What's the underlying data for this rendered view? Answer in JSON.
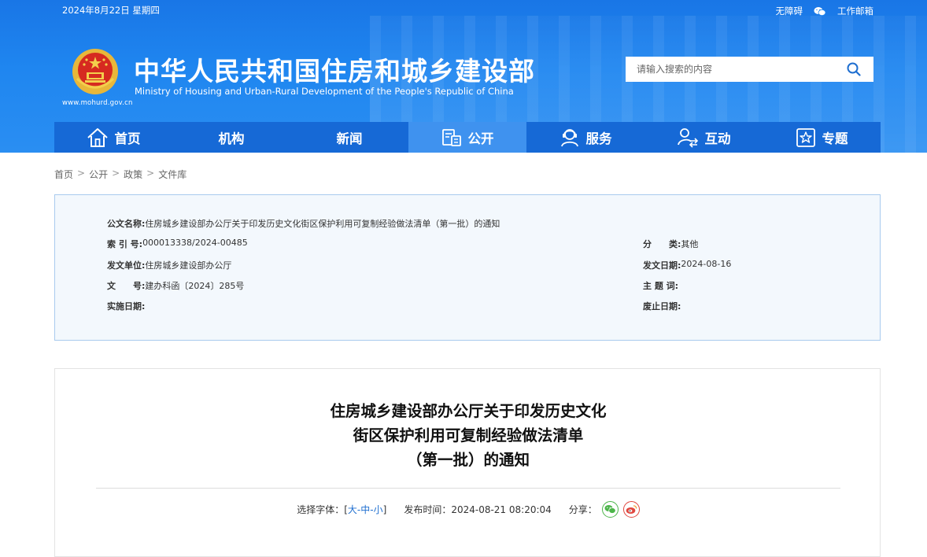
{
  "header": {
    "date": "2024年8月22日 星期四",
    "accessibility_link": "无障碍",
    "work_mail_link": "工作邮箱",
    "logo_url_text": "www.mohurd.gov.cn",
    "title_cn": "中华人民共和国住房和城乡建设部",
    "title_en": "Ministry of Housing and Urban-Rural Development of the People's Republic of China",
    "search_placeholder": "请输入搜索的内容"
  },
  "nav": {
    "items": [
      {
        "label": "首页",
        "icon": "home-icon"
      },
      {
        "label": "机构",
        "icon": ""
      },
      {
        "label": "新闻",
        "icon": ""
      },
      {
        "label": "公开",
        "icon": "document-icon",
        "active": true
      },
      {
        "label": "服务",
        "icon": "service-user-icon"
      },
      {
        "label": "互动",
        "icon": "interact-user-icon"
      },
      {
        "label": "专题",
        "icon": "star-icon"
      }
    ]
  },
  "breadcrumb": [
    "首页",
    "公开",
    "政策",
    "文件库"
  ],
  "info": {
    "doc_name_label": "公文名称:",
    "doc_name_value": "住房城乡建设部办公厅关于印发历史文化街区保护利用可复制经验做法清单（第一批）的通知",
    "index_label": "索 引 号:",
    "index_value": "000013338/2024-00485",
    "category_label": "分　　类:",
    "category_value": "其他",
    "issuer_label": "发文单位:",
    "issuer_value": "住房城乡建设部办公厅",
    "issue_date_label": "发文日期:",
    "issue_date_value": "2024-08-16",
    "doc_no_label": "文　　号:",
    "doc_no_value": "建办科函〔2024〕285号",
    "subject_label": "主 题 词:",
    "subject_value": "",
    "effective_label": "实施日期:",
    "effective_value": "",
    "expiry_label": "废止日期:",
    "expiry_value": ""
  },
  "article": {
    "title_line1": "住房城乡建设部办公厅关于印发历史文化",
    "title_line2": "街区保护利用可复制经验做法清单",
    "title_line3": "（第一批）的通知",
    "font_label": "选择字体：[",
    "font_large": "大",
    "font_medium": "中",
    "font_small": "小",
    "font_dash": "-",
    "font_close": "]",
    "publish_label": "发布时间：",
    "publish_time": "2024-08-21 08:20:04",
    "share_label": "分享：",
    "share_icons": [
      "wechat-share-icon",
      "weibo-share-icon"
    ]
  },
  "colors": {
    "header_blue": "#1f86f0",
    "nav_blue": "#1669d6",
    "nav_active": "#3f92ef",
    "info_bg": "#f3f8fd",
    "info_border": "#a9cbee",
    "link_blue": "#1f6fd0",
    "wechat_green": "#4cb54a",
    "weibo_red": "#e0463e"
  }
}
